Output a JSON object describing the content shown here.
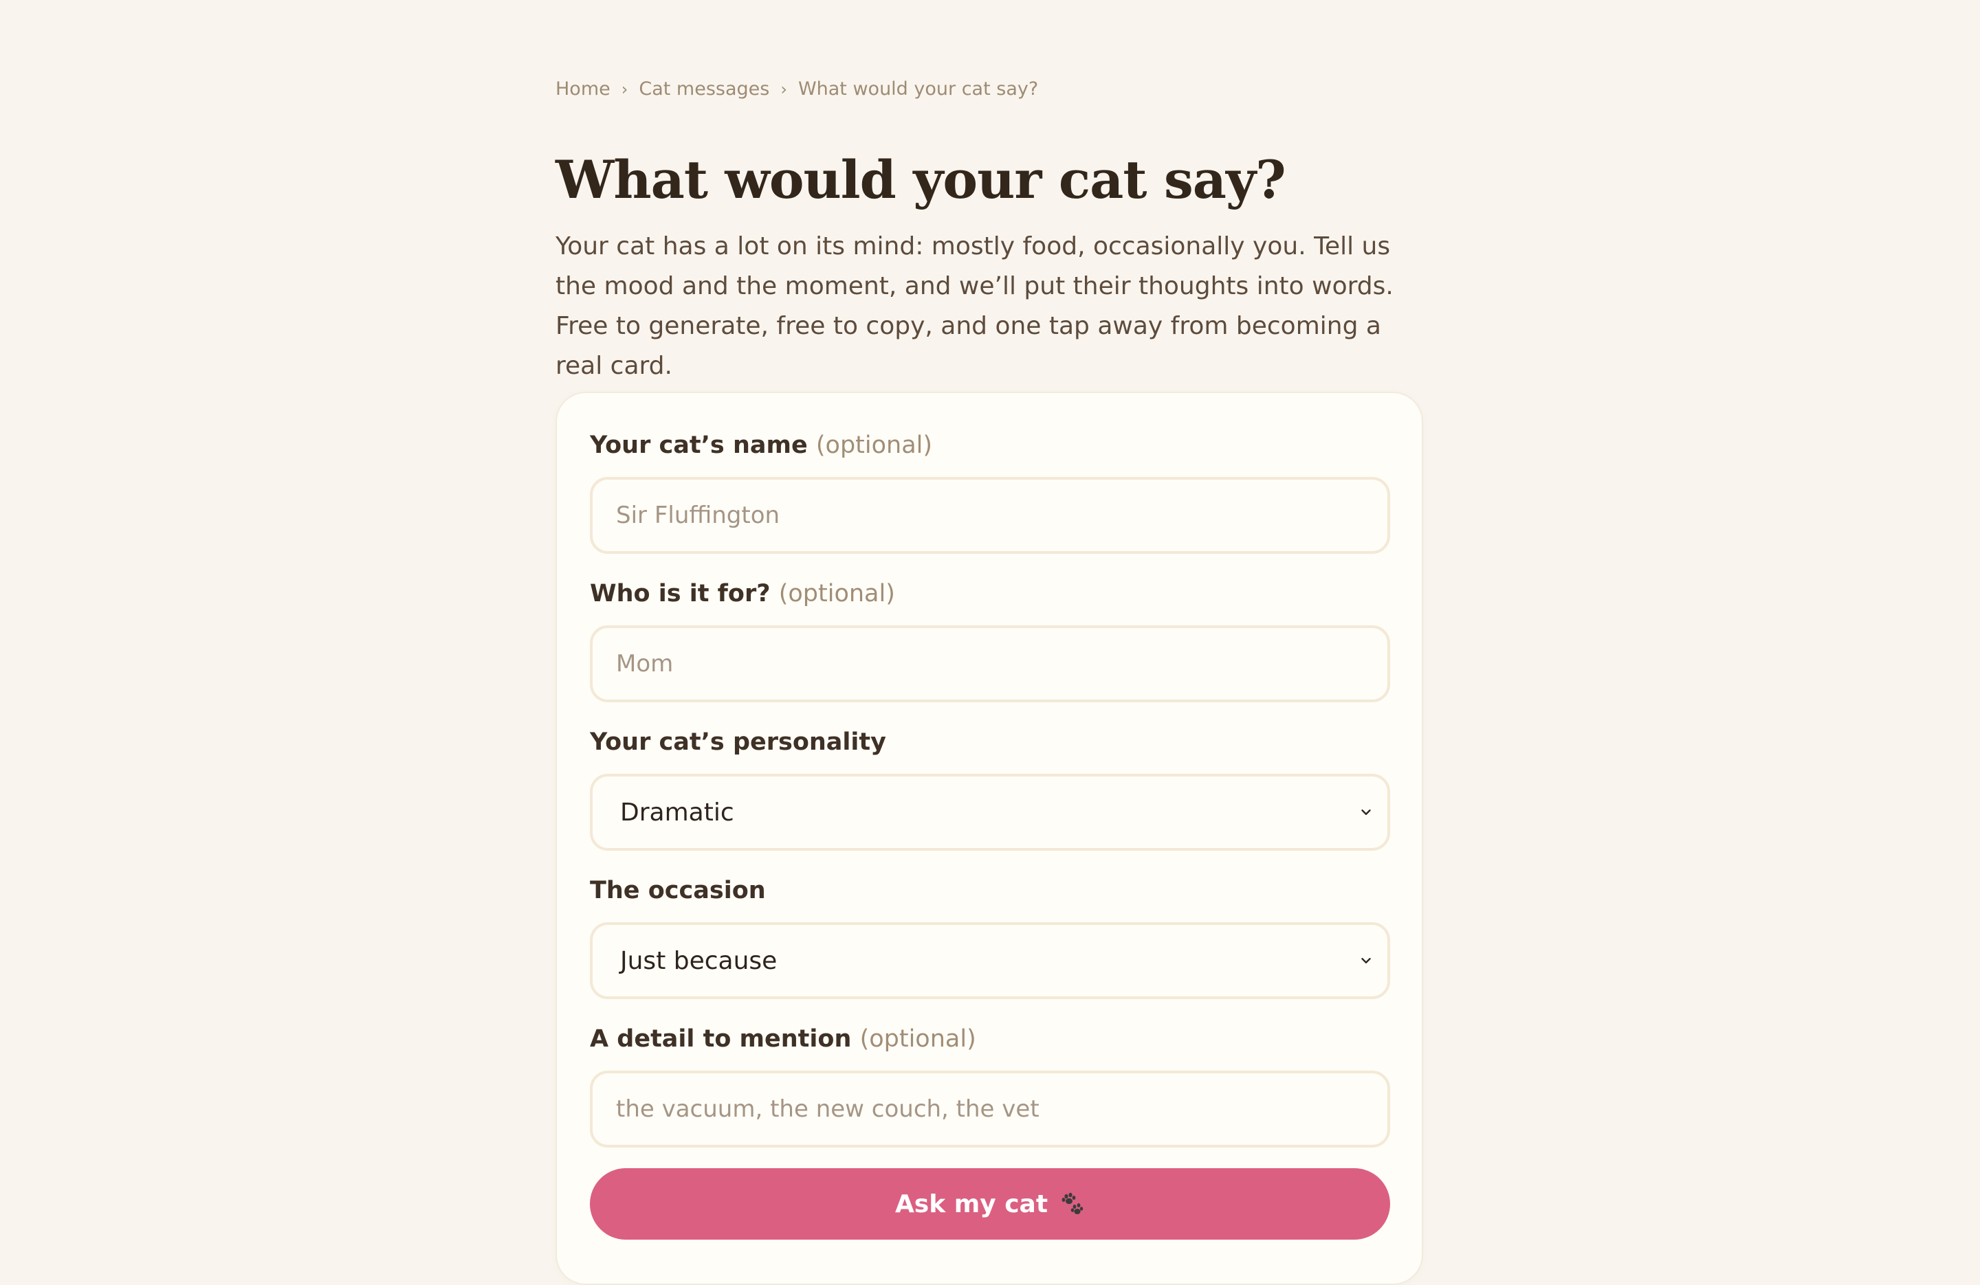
{
  "breadcrumb": {
    "items": [
      "Home",
      "Cat messages",
      "What would your cat say?"
    ],
    "separator": "›"
  },
  "header": {
    "title": "What would your cat say?",
    "intro": "Your cat has a lot on its mind: mostly food, occasionally you. Tell us the mood and the moment, and we’ll put their thoughts into words. Free to generate, free to copy, and one tap away from becoming a real card."
  },
  "form": {
    "cat_name": {
      "label": "Your cat’s name",
      "optional": "(optional)",
      "placeholder": "Sir Fluffington",
      "value": ""
    },
    "recipient": {
      "label": "Who is it for?",
      "optional": "(optional)",
      "placeholder": "Mom",
      "value": ""
    },
    "personality": {
      "label": "Your cat’s personality",
      "selected": "Dramatic",
      "icon": "chevron-down-icon"
    },
    "occasion": {
      "label": "The occasion",
      "selected": "Just because",
      "icon": "chevron-down-icon"
    },
    "detail": {
      "label": "A detail to mention",
      "optional": "(optional)",
      "placeholder": "the vacuum, the new couch, the vet",
      "value": ""
    },
    "submit": {
      "label": "Ask my cat",
      "icon": "paw-prints-icon"
    }
  },
  "colors": {
    "background": "#f9f5ee",
    "card": "#fffdf8",
    "field_border": "#f3e9d6",
    "accent": "#db5f81",
    "heading": "#33271c",
    "muted": "#a18d76"
  }
}
